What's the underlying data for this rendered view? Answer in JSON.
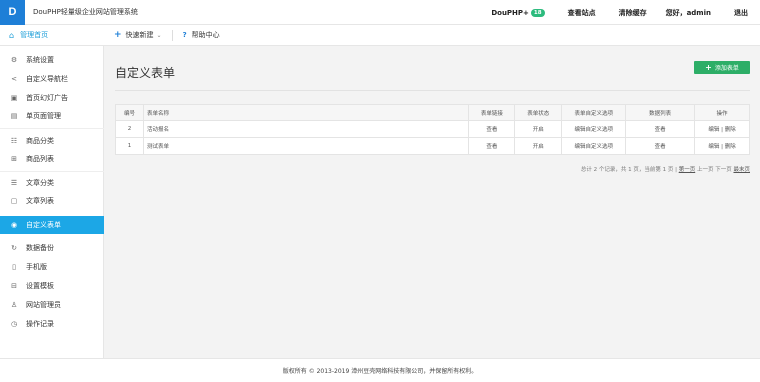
{
  "header": {
    "logo_text": "D",
    "system_title": "DouPHP轻量级企业网站管理系统",
    "brand": "DouPHP+",
    "brand_badge": "18",
    "view_site": "查看站点",
    "clear_cache": "清除缓存",
    "greeting": "您好，admin",
    "logout": "退出"
  },
  "subbar": {
    "home_label": "管理首页",
    "quick_new": "快速新建",
    "help_center": "帮助中心"
  },
  "sidebar": {
    "items": [
      {
        "icon": "⚙",
        "label": "系统设置"
      },
      {
        "icon": "<",
        "label": "自定义导航栏"
      },
      {
        "icon": "▣",
        "label": "首页幻灯广告"
      },
      {
        "icon": "▤",
        "label": "单页面管理"
      },
      {
        "icon": "☷",
        "label": "商品分类"
      },
      {
        "icon": "⊞",
        "label": "商品列表"
      },
      {
        "icon": "☰",
        "label": "文章分类"
      },
      {
        "icon": "▢",
        "label": "文章列表"
      },
      {
        "icon": "◉",
        "label": "自定义表单"
      },
      {
        "icon": "↻",
        "label": "数据备份"
      },
      {
        "icon": "▯",
        "label": "手机版"
      },
      {
        "icon": "⊟",
        "label": "设置模板"
      },
      {
        "icon": "♙",
        "label": "网站管理员"
      },
      {
        "icon": "◷",
        "label": "操作记录"
      }
    ]
  },
  "main": {
    "title": "自定义表单",
    "add_button": "添加表单",
    "table": {
      "headers": [
        "编号",
        "表单名称",
        "表单链接",
        "表单状态",
        "表单自定义选项",
        "数据列表",
        "操作"
      ],
      "rows": [
        {
          "id": "2",
          "name": "活动报名",
          "link": "查看",
          "status": "开启",
          "options": "编辑自定义选项",
          "data": "查看",
          "edit": "编辑",
          "del": "删除"
        },
        {
          "id": "1",
          "name": "测试表单",
          "link": "查看",
          "status": "开启",
          "options": "编辑自定义选项",
          "data": "查看",
          "edit": "编辑",
          "del": "删除"
        }
      ]
    },
    "pager": {
      "summary": "总计 2 个记录，共 1 页，当前第 1 页 |",
      "first": "第一页",
      "prev": "上一页",
      "next": "下一页",
      "last": "最末页"
    }
  },
  "footer": {
    "copyright": "版权所有 © 2013-2019 漳州豆壳网络科技有限公司，并保留所有权利。"
  }
}
